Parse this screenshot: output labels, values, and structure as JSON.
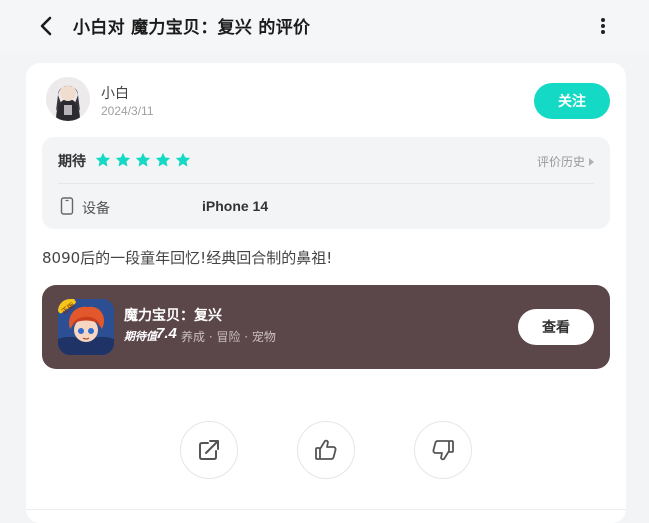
{
  "header": {
    "title": "小白对 魔力宝贝：复兴 的评价",
    "back_icon": "chevron-left-icon",
    "more_icon": "more-vertical-icon"
  },
  "author": {
    "name": "小白",
    "date": "2024/3/11",
    "follow_label": "关注"
  },
  "rating": {
    "label": "期待",
    "stars": 5,
    "star_color": "#14d9c5",
    "history_label": "评价历史",
    "device_label": "设备",
    "device_value": "iPhone 14"
  },
  "review": {
    "text": "8090后的一段童年回忆!经典回合制的鼻祖!"
  },
  "game": {
    "name": "魔力宝贝：复兴",
    "score_label": "期待值",
    "score": "7.4",
    "tags": "养成 · 冒险 · 宠物",
    "view_label": "查看",
    "icon_badge": "正版"
  },
  "actions": {
    "share_icon": "share-icon",
    "like_icon": "thumbs-up-icon",
    "dislike_icon": "thumbs-down-icon"
  },
  "colors": {
    "accent": "#14d9c5",
    "game_card_bg": "#5b464a"
  }
}
